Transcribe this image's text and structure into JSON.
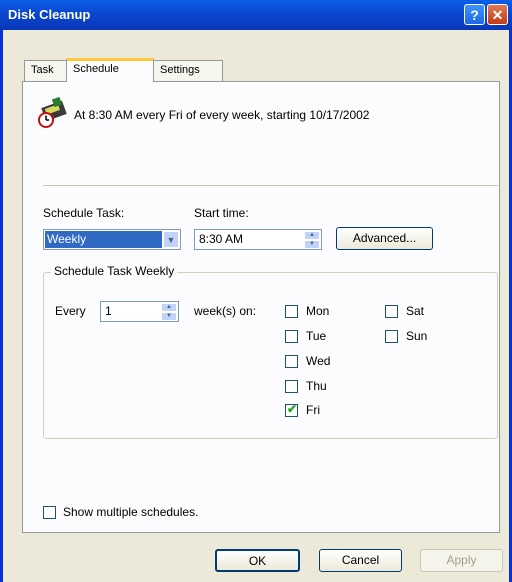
{
  "window": {
    "title": "Disk Cleanup"
  },
  "tabs": [
    {
      "label": "Task"
    },
    {
      "label": "Schedule"
    },
    {
      "label": "Settings"
    }
  ],
  "summary": "At 8:30 AM every Fri of every week, starting 10/17/2002",
  "schedule_task": {
    "label": "Schedule Task:",
    "value": "Weekly"
  },
  "start_time": {
    "label": "Start time:",
    "value": "8:30 AM"
  },
  "advanced_label": "Advanced...",
  "weekly_group": {
    "legend": "Schedule Task Weekly",
    "every_label": "Every",
    "every_value": "1",
    "weeks_on_label": "week(s) on:",
    "days": [
      {
        "label": "Mon",
        "checked": false
      },
      {
        "label": "Tue",
        "checked": false
      },
      {
        "label": "Wed",
        "checked": false
      },
      {
        "label": "Thu",
        "checked": false
      },
      {
        "label": "Fri",
        "checked": true
      },
      {
        "label": "Sat",
        "checked": false
      },
      {
        "label": "Sun",
        "checked": false
      }
    ]
  },
  "show_multiple": {
    "label": "Show multiple schedules.",
    "checked": false
  },
  "buttons": {
    "ok": "OK",
    "cancel": "Cancel",
    "apply": "Apply"
  },
  "colors": {
    "titlebar": "#0b49d1",
    "selection": "#316ac5",
    "tab_highlight": "#ffc83c"
  }
}
